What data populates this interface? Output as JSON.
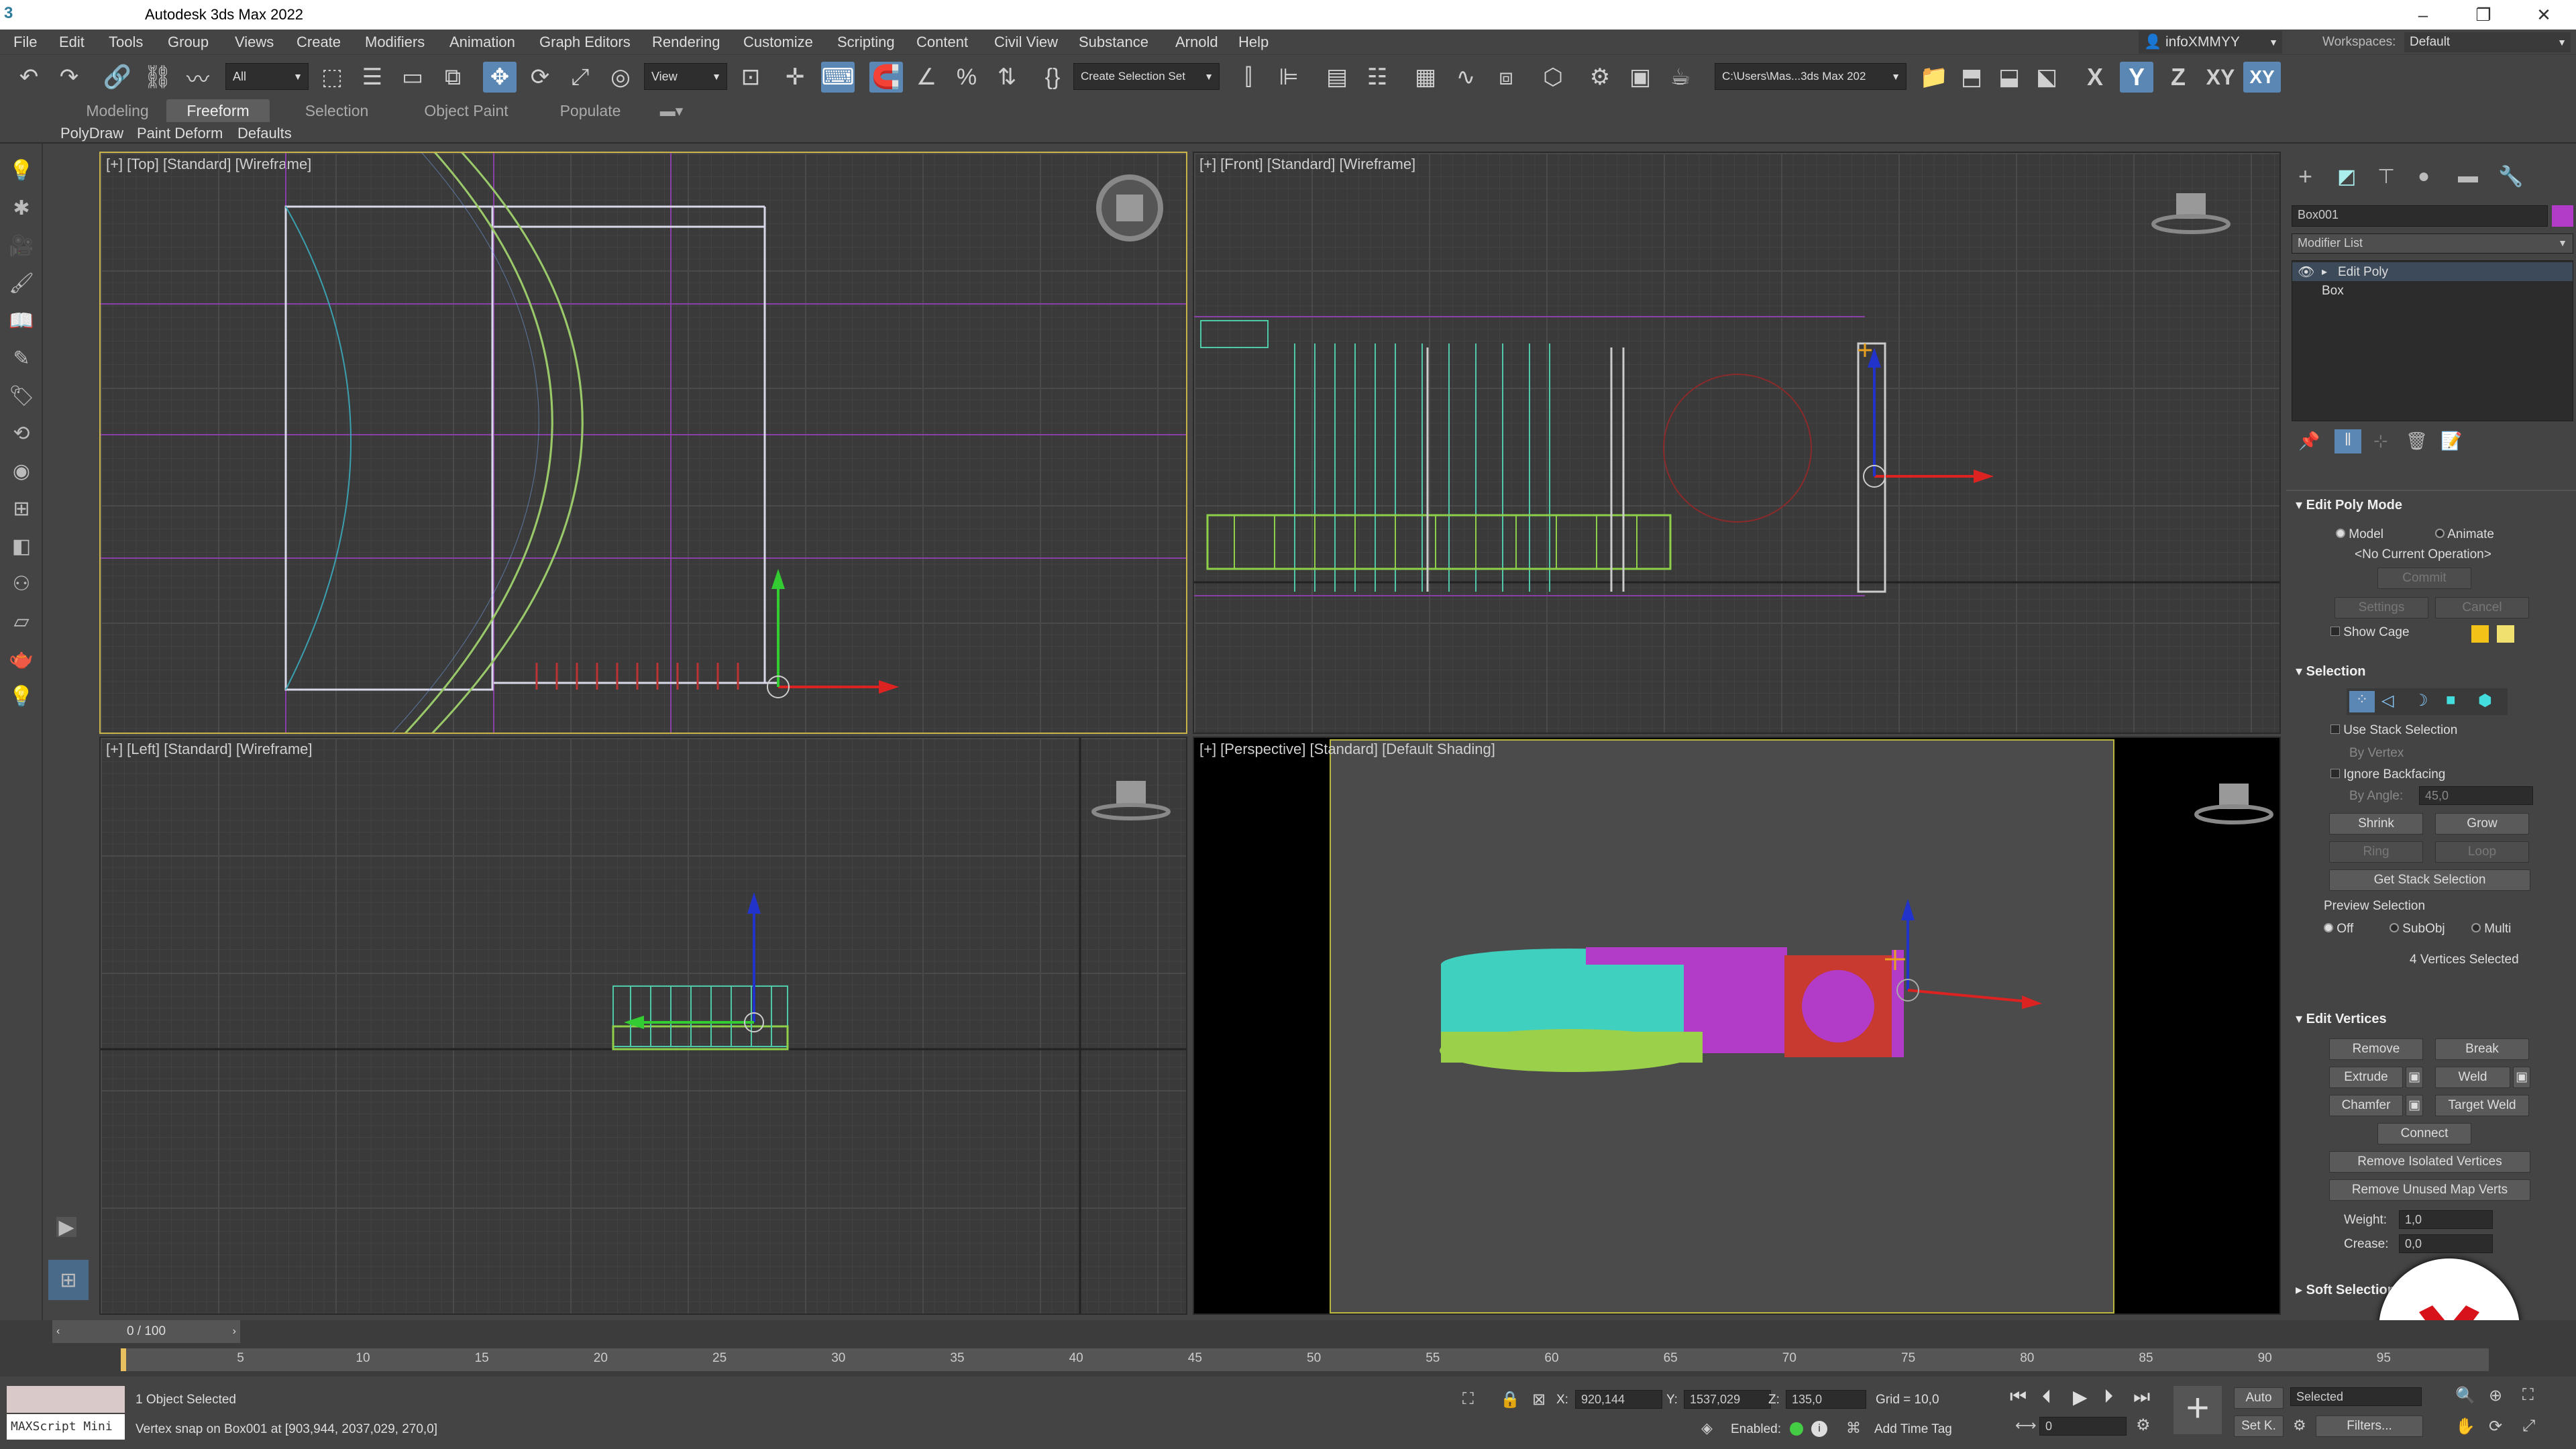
{
  "app": {
    "title": "Autodesk 3ds Max 2022"
  },
  "menu": [
    "File",
    "Edit",
    "Tools",
    "Group",
    "Views",
    "Create",
    "Modifiers",
    "Animation",
    "Graph Editors",
    "Rendering",
    "Customize",
    "Scripting",
    "Content",
    "Civil View",
    "Substance",
    "Arnold",
    "Help"
  ],
  "user": {
    "name": "infoXMMYY",
    "workspaces_label": "Workspaces:",
    "workspace": "Default"
  },
  "toolbar": {
    "filter": "All",
    "refcoord": "View",
    "selection_set": "Create Selection Set",
    "path": "C:\\Users\\Mas...3ds Max 202",
    "axes": [
      "X",
      "Y",
      "Z",
      "XY",
      "XY"
    ]
  },
  "ribbon": {
    "tabs": [
      "Modeling",
      "Freeform",
      "Selection",
      "Object Paint",
      "Populate"
    ],
    "active": "Freeform",
    "subtabs": [
      "PolyDraw",
      "Paint Deform",
      "Defaults"
    ]
  },
  "viewports": {
    "top": "[+] [Top] [Standard] [Wireframe]",
    "front": "[+] [Front] [Standard] [Wireframe]",
    "left": "[+] [Left] [Standard] [Wireframe]",
    "perspective": "[+] [Perspective] [Standard] [Default Shading]"
  },
  "command_panel": {
    "object_name": "Box001",
    "object_color": "#b23cc8",
    "modifier_list": "Modifier List",
    "stack": [
      "Edit Poly",
      "Box"
    ],
    "edit_poly_mode": {
      "title": "Edit Poly Mode",
      "model": "Model",
      "animate": "Animate",
      "operation": "<No Current Operation>",
      "commit": "Commit",
      "settings": "Settings",
      "cancel": "Cancel",
      "show_cage": "Show Cage"
    },
    "selection": {
      "title": "Selection",
      "use_stack": "Use Stack Selection",
      "by_vertex": "By Vertex",
      "ignore_backfacing": "Ignore Backfacing",
      "by_angle": "By Angle:",
      "angle": "45,0",
      "shrink": "Shrink",
      "grow": "Grow",
      "ring": "Ring",
      "loop": "Loop",
      "get_stack": "Get Stack Selection",
      "preview_title": "Preview Selection",
      "off": "Off",
      "subobj": "SubObj",
      "multi": "Multi",
      "status": "4 Vertices Selected"
    },
    "edit_vertices": {
      "title": "Edit Vertices",
      "remove": "Remove",
      "break": "Break",
      "extrude": "Extrude",
      "weld": "Weld",
      "chamfer": "Chamfer",
      "target_weld": "Target Weld",
      "connect": "Connect",
      "remove_isolated": "Remove Isolated Vertices",
      "remove_unused": "Remove Unused Map Verts",
      "weight_label": "Weight:",
      "weight": "1,0",
      "crease_label": "Crease:",
      "crease": "0,0"
    },
    "soft_selection": "Soft Selection"
  },
  "timeline": {
    "frame": "0 / 100",
    "ticks": [
      "5",
      "10",
      "15",
      "20",
      "25",
      "30",
      "35",
      "40",
      "45",
      "50",
      "55",
      "60",
      "65",
      "70",
      "75",
      "80",
      "85",
      "90",
      "95"
    ]
  },
  "status": {
    "maxscript": "MAXScript Mini",
    "selected": "1 Object Selected",
    "prompt": "Vertex snap on Box001 at [903,944, 2037,029, 270,0]",
    "x_label": "X:",
    "x": "920,144",
    "y_label": "Y:",
    "y": "1537,029",
    "z_label": "Z:",
    "z": "135,0",
    "grid": "Grid = 10,0",
    "enabled": "Enabled:",
    "add_time_tag": "Add Time Tag",
    "auto": "Auto",
    "set_key": "Set K.",
    "selected_mode": "Selected",
    "filters": "Filters...",
    "frame_field": "0"
  }
}
